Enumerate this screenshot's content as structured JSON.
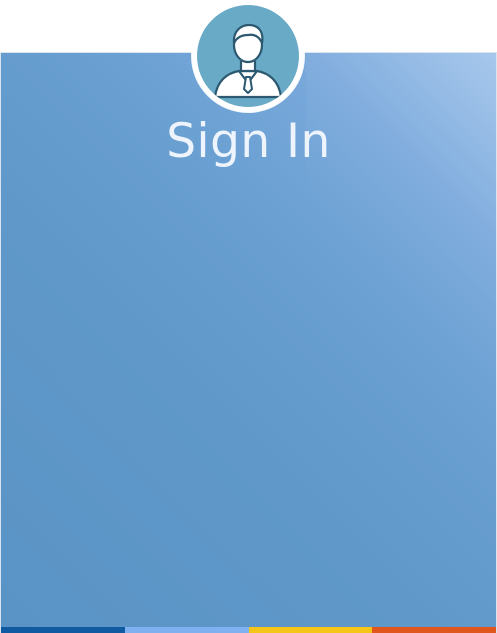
{
  "header": {
    "title": "Sign In"
  },
  "avatar": {
    "icon": "user-avatar-icon",
    "color": "#69abc7"
  },
  "panel": {
    "gradient_colors": [
      "#9bc0ea",
      "#5a93c5"
    ]
  },
  "footer_bar": {
    "colors": [
      "#0f5aa0",
      "#7fb0ef",
      "#f5c617",
      "#e0561c"
    ]
  }
}
